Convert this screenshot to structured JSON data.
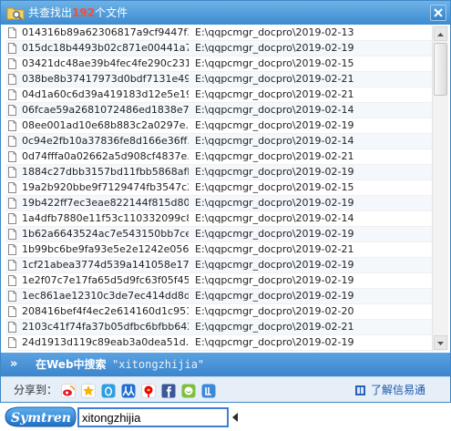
{
  "title": {
    "prefix": "共查找出",
    "count": "192",
    "suffix": "个文件"
  },
  "files": [
    {
      "name": "014316b89a62306817a9cf9447f3...",
      "path": "E:\\qqpcmgr_docpro\\2019-02-13"
    },
    {
      "name": "015dc18b4493b02c871e00441a7...",
      "path": "E:\\qqpcmgr_docpro\\2019-02-19"
    },
    {
      "name": "03421dc48ae39b4fec4fe290c231...",
      "path": "E:\\qqpcmgr_docpro\\2019-02-15"
    },
    {
      "name": "038be8b37417973d0bdf7131e49f...",
      "path": "E:\\qqpcmgr_docpro\\2019-02-21"
    },
    {
      "name": "04d1a60c6d39a419183d12e5e19...",
      "path": "E:\\qqpcmgr_docpro\\2019-02-21"
    },
    {
      "name": "06fcae59a2681072486ed1838e7...",
      "path": "E:\\qqpcmgr_docpro\\2019-02-14"
    },
    {
      "name": "08ee001ad10e68b883c2a0297e...",
      "path": "E:\\qqpcmgr_docpro\\2019-02-19"
    },
    {
      "name": "0c94e2fb10a37836fe8d166e36ff...",
      "path": "E:\\qqpcmgr_docpro\\2019-02-14"
    },
    {
      "name": "0d74fffa0a02662a5d908cf4837e...",
      "path": "E:\\qqpcmgr_docpro\\2019-02-21"
    },
    {
      "name": "1884c27dbb3157bd11fbb5868afb...",
      "path": "E:\\qqpcmgr_docpro\\2019-02-19"
    },
    {
      "name": "19a2b920bbe9f7129474fb3547c2...",
      "path": "E:\\qqpcmgr_docpro\\2019-02-15"
    },
    {
      "name": "19b422ff7ec3eae822144f815d80...",
      "path": "E:\\qqpcmgr_docpro\\2019-02-19"
    },
    {
      "name": "1a4dfb7880e11f53c110332099c8...",
      "path": "E:\\qqpcmgr_docpro\\2019-02-14"
    },
    {
      "name": "1b62a6643524ac7e543150bb7ce...",
      "path": "E:\\qqpcmgr_docpro\\2019-02-19"
    },
    {
      "name": "1b99bc6be9fa93e5e2e1242e056...",
      "path": "E:\\qqpcmgr_docpro\\2019-02-21"
    },
    {
      "name": "1cf21abea3774d539a141058e17...",
      "path": "E:\\qqpcmgr_docpro\\2019-02-19"
    },
    {
      "name": "1e2f07c7e17fa65d5d9fc63f05f45...",
      "path": "E:\\qqpcmgr_docpro\\2019-02-19"
    },
    {
      "name": "1ec861ae12310c3de7ec414dd8d...",
      "path": "E:\\qqpcmgr_docpro\\2019-02-19"
    },
    {
      "name": "208416bef4f4ec2e614160d1c951...",
      "path": "E:\\qqpcmgr_docpro\\2019-02-20"
    },
    {
      "name": "2103c41f74fa37b05dfbc6bfbb642...",
      "path": "E:\\qqpcmgr_docpro\\2019-02-21"
    },
    {
      "name": "24d1913d119c89eab3a0dea51d...",
      "path": "E:\\qqpcmgr_docpro\\2019-02-19"
    }
  ],
  "web_search": {
    "arrows": "»",
    "label": "在Web中搜索",
    "query": "\"xitongzhijia\""
  },
  "share": {
    "label": "分享到：",
    "icons": [
      "weibo-icon",
      "qzone-star-icon",
      "qq-icon",
      "renren-icon",
      "sohu-icon",
      "douban-icon",
      "facebook-icon",
      "kaixin-icon",
      "tieba-icon"
    ]
  },
  "help_link": "了解信易通",
  "search": {
    "logo": "Symtren",
    "value": "xitongzhijia"
  },
  "colors": {
    "title_bar": "#3c8bd0",
    "count": "#ff4b2b",
    "link": "#1a56a8",
    "input_border": "#3e7fd1"
  }
}
